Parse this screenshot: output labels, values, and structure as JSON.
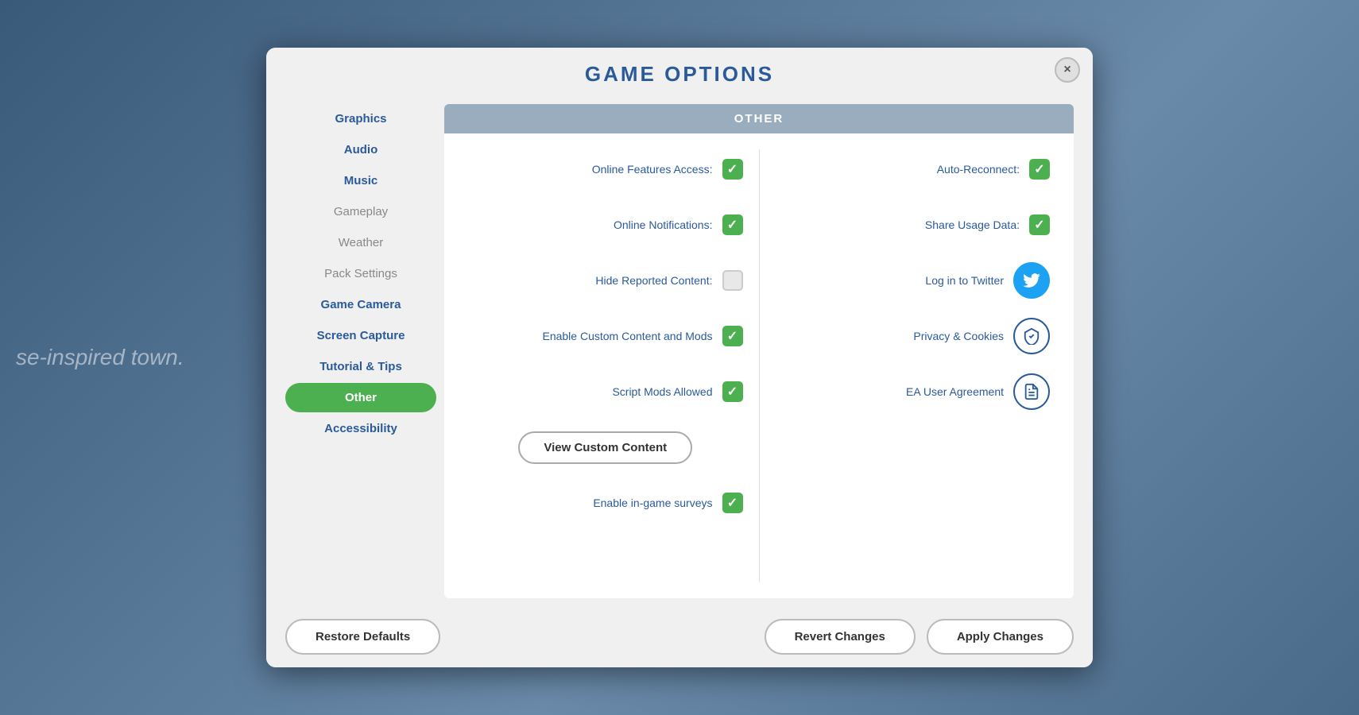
{
  "modal": {
    "title": "Game Options",
    "close_label": "×"
  },
  "sidebar": {
    "items": [
      {
        "id": "graphics",
        "label": "Graphics",
        "state": "bold"
      },
      {
        "id": "audio",
        "label": "Audio",
        "state": "bold"
      },
      {
        "id": "music",
        "label": "Music",
        "state": "bold"
      },
      {
        "id": "gameplay",
        "label": "Gameplay",
        "state": "inactive"
      },
      {
        "id": "weather",
        "label": "Weather",
        "state": "inactive"
      },
      {
        "id": "pack-settings",
        "label": "Pack Settings",
        "state": "inactive"
      },
      {
        "id": "game-camera",
        "label": "Game Camera",
        "state": "bold"
      },
      {
        "id": "screen-capture",
        "label": "Screen Capture",
        "state": "bold"
      },
      {
        "id": "tutorial-tips",
        "label": "Tutorial & Tips",
        "state": "bold"
      },
      {
        "id": "other",
        "label": "Other",
        "state": "active"
      },
      {
        "id": "accessibility",
        "label": "Accessibility",
        "state": "bold"
      }
    ]
  },
  "content": {
    "header": "Other",
    "left_options": [
      {
        "id": "online-features",
        "label": "Online Features Access:",
        "checked": true,
        "type": "checkbox"
      },
      {
        "id": "online-notifications",
        "label": "Online Notifications:",
        "checked": true,
        "type": "checkbox"
      },
      {
        "id": "hide-reported",
        "label": "Hide Reported Content:",
        "checked": false,
        "type": "checkbox"
      },
      {
        "id": "enable-custom",
        "label": "Enable Custom Content and Mods",
        "checked": true,
        "type": "checkbox"
      },
      {
        "id": "script-mods",
        "label": "Script Mods Allowed",
        "checked": true,
        "type": "checkbox"
      },
      {
        "id": "view-custom",
        "label": "View Custom Content",
        "type": "button"
      },
      {
        "id": "enable-surveys",
        "label": "Enable in-game surveys",
        "checked": true,
        "type": "checkbox"
      }
    ],
    "right_options": [
      {
        "id": "auto-reconnect",
        "label": "Auto-Reconnect:",
        "checked": true,
        "type": "checkbox"
      },
      {
        "id": "share-usage",
        "label": "Share Usage Data:",
        "checked": true,
        "type": "checkbox"
      },
      {
        "id": "log-twitter",
        "label": "Log in to Twitter",
        "type": "icon",
        "icon": "twitter"
      },
      {
        "id": "privacy-cookies",
        "label": "Privacy & Cookies",
        "type": "icon",
        "icon": "shield"
      },
      {
        "id": "ea-agreement",
        "label": "EA User Agreement",
        "type": "icon",
        "icon": "doc"
      }
    ]
  },
  "footer": {
    "restore_defaults": "Restore Defaults",
    "revert_changes": "Revert Changes",
    "apply_changes": "Apply Changes"
  }
}
